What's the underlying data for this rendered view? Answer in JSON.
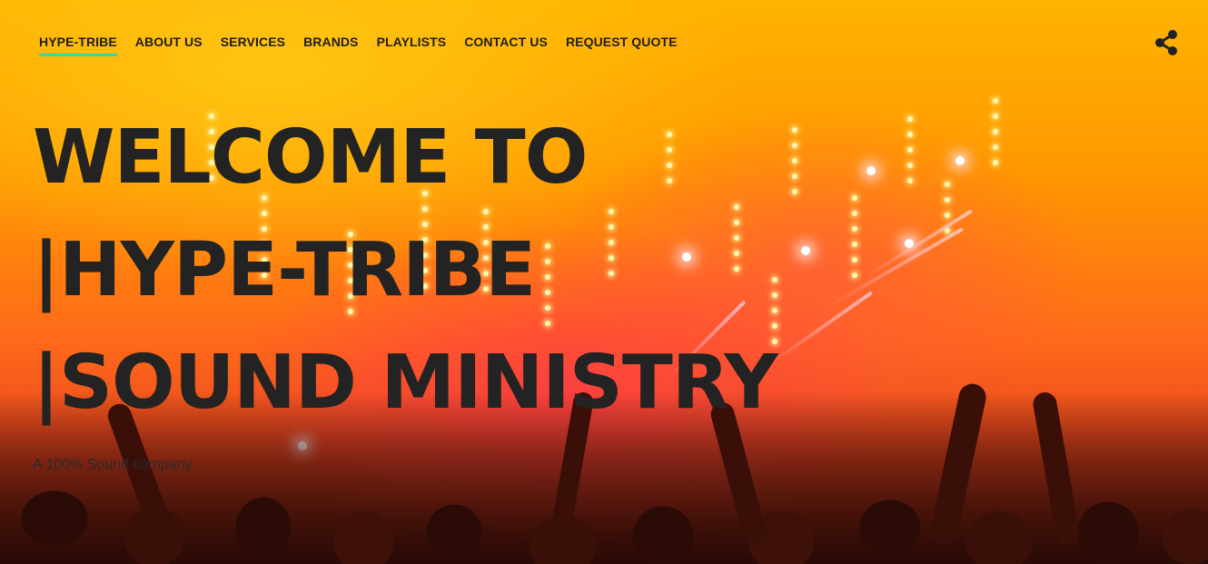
{
  "nav": {
    "items": [
      {
        "label": "HYPE-TRIBE",
        "active": true
      },
      {
        "label": "ABOUT US",
        "active": false
      },
      {
        "label": "SERVICES",
        "active": false
      },
      {
        "label": "BRANDS",
        "active": false
      },
      {
        "label": "PLAYLISTS",
        "active": false
      },
      {
        "label": "CONTACT US",
        "active": false
      },
      {
        "label": "REQUEST QUOTE",
        "active": false
      }
    ],
    "active_underline_color": "#2fd7b3",
    "share_icon": "share-icon"
  },
  "hero": {
    "headline_lines": [
      "WELCOME TO",
      "|HYPE-TRIBE",
      "|SOUND MINISTRY"
    ],
    "tagline": "A 100% Sound company",
    "background": "concert-crowd-stage-lights"
  },
  "colors": {
    "text_dark": "#232323",
    "accent": "#2fd7b3",
    "background_warm": "#ff9900"
  }
}
